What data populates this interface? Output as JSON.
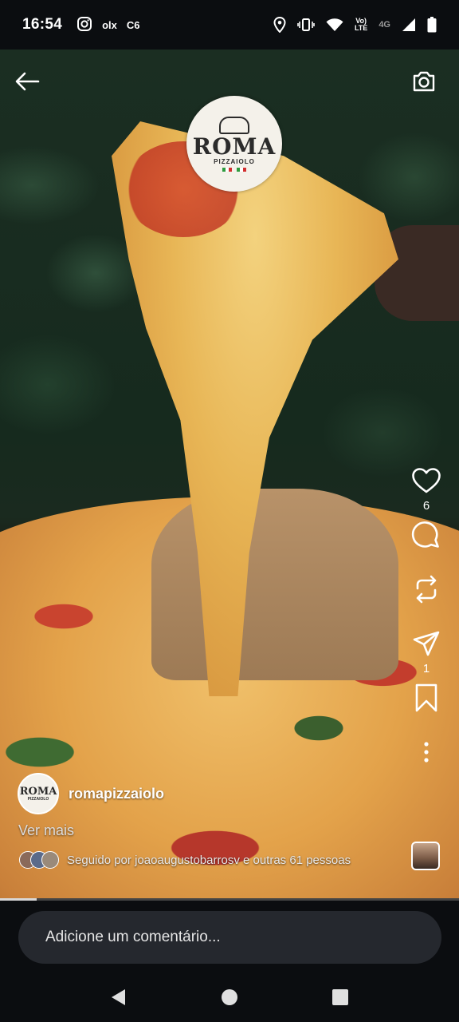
{
  "status_bar": {
    "time": "16:54",
    "left_icons": [
      "instagram-icon",
      "olx",
      "c6"
    ],
    "olx_label": "olx",
    "c6_label": "C6",
    "lte_top": "Vo)",
    "lte_bottom": "LTE",
    "network": "4G",
    "right_icons": [
      "location-icon",
      "vibrate-icon",
      "wifi-icon",
      "volte-icon",
      "signal-icon",
      "battery-icon"
    ]
  },
  "video": {
    "logo": {
      "name": "ROMA",
      "subtitle": "PIZZAIOLO"
    }
  },
  "actions": {
    "likes": "6",
    "shares": "1"
  },
  "caption": {
    "avatar_name": "ROMA",
    "avatar_sub": "PIZZAIOLO",
    "username": "romapizzaiolo",
    "more": "Ver mais",
    "followed_by": "Seguido por joaoaugustobarrosv e outras 61 pessoas"
  },
  "progress": {
    "fraction": 0.08
  },
  "comment": {
    "placeholder": "Adicione um comentário..."
  },
  "colors": {
    "background": "#0b0d10",
    "input_bg": "#25282e",
    "accent_green": "#2e9b3e",
    "accent_red": "#d32f2f"
  }
}
